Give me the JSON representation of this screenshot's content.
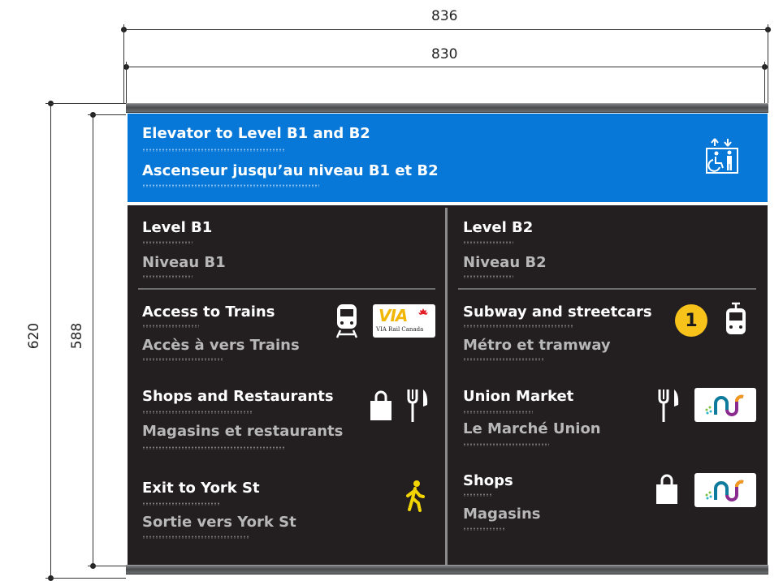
{
  "dimensions": {
    "outer_width": "836",
    "inner_width": "830",
    "outer_height": "620",
    "inner_height": "588"
  },
  "header": {
    "title_en": "Elevator to Level B1 and B2",
    "title_fr": "Ascenseur jusqu’au niveau B1 et B2",
    "icon": "elevator-accessible-icon"
  },
  "left": {
    "level_en": "Level B1",
    "level_fr": "Niveau B1",
    "items": [
      {
        "en": "Access to Trains",
        "fr": "Accès à vers Trains",
        "icons": [
          "train-icon",
          "via-rail-logo"
        ]
      },
      {
        "en": "Shops and Restaurants",
        "fr": "Magasins et restaurants",
        "icons": [
          "shopping-bag-icon",
          "fork-knife-icon"
        ]
      },
      {
        "en": "Exit to York St",
        "fr": "Sortie vers York St",
        "icons": [
          "walking-person-icon"
        ]
      }
    ]
  },
  "right": {
    "level_en": "Level B2",
    "level_fr": "Niveau B2",
    "items": [
      {
        "en": "Subway and streetcars",
        "fr": "Métro et tramway",
        "badge": "1",
        "icons": [
          "subway-line-badge",
          "streetcar-icon"
        ]
      },
      {
        "en": "Union Market",
        "fr": "Le Marché Union",
        "icons": [
          "fork-knife-icon",
          "union-logo"
        ]
      },
      {
        "en": "Shops",
        "fr": "Magasins",
        "icons": [
          "shopping-bag-icon",
          "union-logo"
        ]
      }
    ]
  },
  "via_logo": {
    "main": "VIA",
    "sub": "VIA Rail Canada"
  },
  "colors": {
    "header_blue": "#0878d8",
    "panel_dark": "#231f20",
    "badge_yellow": "#f7c21a",
    "pedestrian_yellow": "#f2d500",
    "via_red": "#e21f26"
  }
}
